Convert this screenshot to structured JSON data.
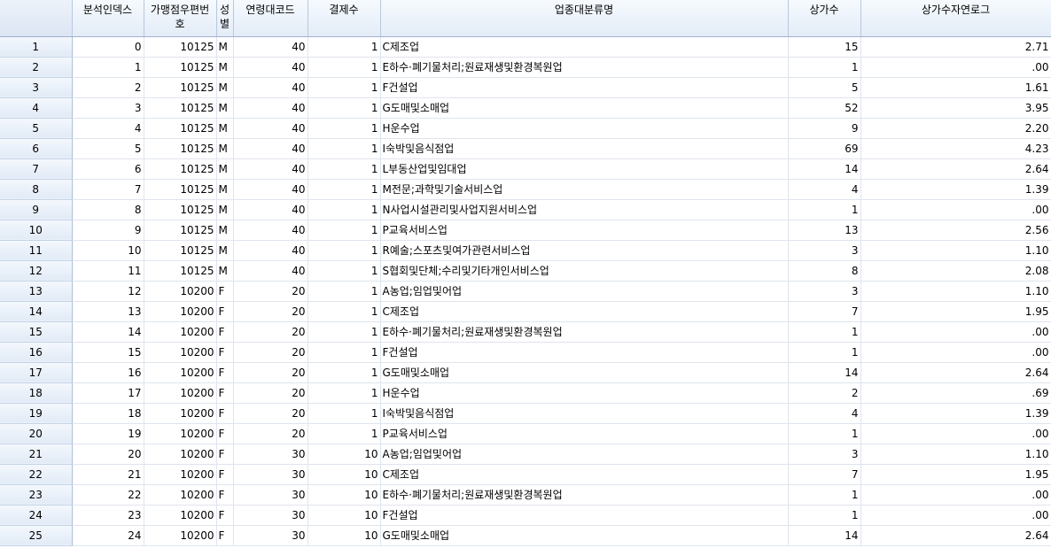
{
  "columns": [
    "",
    "분석인덱스",
    "가맹점우편번호",
    "성별",
    "연령대코드",
    "결제수",
    "업종대분류명",
    "상가수",
    "상가수자연로그"
  ],
  "rows": [
    [
      "1",
      "0",
      "10125",
      "M",
      "40",
      "1",
      "C제조업",
      "15",
      "2.71"
    ],
    [
      "2",
      "1",
      "10125",
      "M",
      "40",
      "1",
      "E하수·폐기물처리;원료재생및환경복원업",
      "1",
      ".00"
    ],
    [
      "3",
      "2",
      "10125",
      "M",
      "40",
      "1",
      "F건설업",
      "5",
      "1.61"
    ],
    [
      "4",
      "3",
      "10125",
      "M",
      "40",
      "1",
      "G도매및소매업",
      "52",
      "3.95"
    ],
    [
      "5",
      "4",
      "10125",
      "M",
      "40",
      "1",
      "H운수업",
      "9",
      "2.20"
    ],
    [
      "6",
      "5",
      "10125",
      "M",
      "40",
      "1",
      "I숙박및음식점업",
      "69",
      "4.23"
    ],
    [
      "7",
      "6",
      "10125",
      "M",
      "40",
      "1",
      "L부동산업및임대업",
      "14",
      "2.64"
    ],
    [
      "8",
      "7",
      "10125",
      "M",
      "40",
      "1",
      "M전문;과학및기술서비스업",
      "4",
      "1.39"
    ],
    [
      "9",
      "8",
      "10125",
      "M",
      "40",
      "1",
      "N사업시설관리및사업지원서비스업",
      "1",
      ".00"
    ],
    [
      "10",
      "9",
      "10125",
      "M",
      "40",
      "1",
      "P교육서비스업",
      "13",
      "2.56"
    ],
    [
      "11",
      "10",
      "10125",
      "M",
      "40",
      "1",
      "R예술;스포츠및여가관련서비스업",
      "3",
      "1.10"
    ],
    [
      "12",
      "11",
      "10125",
      "M",
      "40",
      "1",
      "S협회및단체;수리및기타개인서비스업",
      "8",
      "2.08"
    ],
    [
      "13",
      "12",
      "10200",
      "F",
      "20",
      "1",
      "A농업;임업및어업",
      "3",
      "1.10"
    ],
    [
      "14",
      "13",
      "10200",
      "F",
      "20",
      "1",
      "C제조업",
      "7",
      "1.95"
    ],
    [
      "15",
      "14",
      "10200",
      "F",
      "20",
      "1",
      "E하수·폐기물처리;원료재생및환경복원업",
      "1",
      ".00"
    ],
    [
      "16",
      "15",
      "10200",
      "F",
      "20",
      "1",
      "F건설업",
      "1",
      ".00"
    ],
    [
      "17",
      "16",
      "10200",
      "F",
      "20",
      "1",
      "G도매및소매업",
      "14",
      "2.64"
    ],
    [
      "18",
      "17",
      "10200",
      "F",
      "20",
      "1",
      "H운수업",
      "2",
      ".69"
    ],
    [
      "19",
      "18",
      "10200",
      "F",
      "20",
      "1",
      "I숙박및음식점업",
      "4",
      "1.39"
    ],
    [
      "20",
      "19",
      "10200",
      "F",
      "20",
      "1",
      "P교육서비스업",
      "1",
      ".00"
    ],
    [
      "21",
      "20",
      "10200",
      "F",
      "30",
      "10",
      "A농업;임업및어업",
      "3",
      "1.10"
    ],
    [
      "22",
      "21",
      "10200",
      "F",
      "30",
      "10",
      "C제조업",
      "7",
      "1.95"
    ],
    [
      "23",
      "22",
      "10200",
      "F",
      "30",
      "10",
      "E하수·폐기물처리;원료재생및환경복원업",
      "1",
      ".00"
    ],
    [
      "24",
      "23",
      "10200",
      "F",
      "30",
      "10",
      "F건설업",
      "1",
      ".00"
    ],
    [
      "25",
      "24",
      "10200",
      "F",
      "30",
      "10",
      "G도매및소매업",
      "14",
      "2.64"
    ]
  ]
}
